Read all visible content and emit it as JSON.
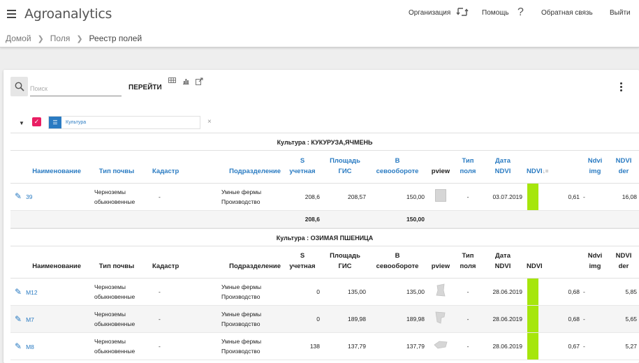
{
  "app": {
    "title": "Agroanalytics"
  },
  "topnav": {
    "organization": "Организация",
    "help": "Помощь",
    "feedback": "Обратная связь",
    "logout": "Выйти"
  },
  "breadcrumb": {
    "home": "Домой",
    "fields": "Поля",
    "current": "Реестр полей"
  },
  "toolbar": {
    "search_placeholder": "Поиск",
    "search_value": "",
    "go_label": "ПЕРЕЙТИ",
    "help_glyph": "?"
  },
  "filter": {
    "chip_label": "Культура",
    "close_glyph": "×"
  },
  "colors": {
    "accent_blue": "#2a7bc2",
    "checkbox_pink": "#e91e63",
    "ndvi_green": "#a6e60c"
  },
  "groups": [
    {
      "title": "Культура : КУКУРУЗА,ЯЧМЕНЬ",
      "header_style": "blue",
      "columns": {
        "name": "Наименование",
        "soil": "Тип почвы",
        "cadastre": "Кадастр",
        "division": "Подразделение",
        "s_acc_1": "S",
        "s_acc_2": "учетная",
        "area_gis_1": "Площадь",
        "area_gis_2": "ГИС",
        "rotation_1": "В",
        "rotation_2": "севообороте",
        "pview": "pview",
        "field_type_1": "Тип",
        "field_type_2": "поля",
        "ndvi_date_1": "Дата",
        "ndvi_date_2": "NDVI",
        "ndvi": "NDVI",
        "ndvi_sort": "↓=",
        "ndvi_img_1": "Ndvi",
        "ndvi_img_2": "img",
        "ndvi_der_1": "NDVI",
        "ndvi_der_2": "der"
      },
      "rows": [
        {
          "name": "39",
          "soil_1": "Черноземы",
          "soil_2": "обыкновенные",
          "cadastre": "-",
          "division_1": "Умные фермы",
          "division_2": "Производство",
          "s_acc": "208,6",
          "area_gis": "208,57",
          "rotation": "150,00",
          "field_type": "-",
          "ndvi_date": "03.07.2019",
          "ndvi": "0,61",
          "ndvi_img": "-",
          "ndvi_der": "16,08"
        }
      ],
      "totals": {
        "s_acc": "208,6",
        "rotation": "150,00"
      }
    },
    {
      "title": "Культура : ОЗИМАЯ ПШЕНИЦА",
      "header_style": "dark",
      "columns": {
        "name": "Наименование",
        "soil": "Тип почвы",
        "cadastre": "Кадастр",
        "division": "Подразделение",
        "s_acc_1": "S",
        "s_acc_2": "учетная",
        "area_gis_1": "Площадь",
        "area_gis_2": "ГИС",
        "rotation_1": "В",
        "rotation_2": "севообороте",
        "pview": "pview",
        "field_type_1": "Тип",
        "field_type_2": "поля",
        "ndvi_date_1": "Дата",
        "ndvi_date_2": "NDVI",
        "ndvi": "NDVI",
        "ndvi_img_1": "Ndvi",
        "ndvi_img_2": "img",
        "ndvi_der_1": "NDVI",
        "ndvi_der_2": "der"
      },
      "rows": [
        {
          "name": "М12",
          "soil_1": "Черноземы",
          "soil_2": "обыкновенные",
          "cadastre": "-",
          "division_1": "Умные фермы",
          "division_2": "Производство",
          "s_acc": "0",
          "area_gis": "135,00",
          "rotation": "135,00",
          "field_type": "-",
          "ndvi_date": "28.06.2019",
          "ndvi": "0,68",
          "ndvi_img": "-",
          "ndvi_der": "5,85"
        },
        {
          "name": "М7",
          "soil_1": "Черноземы",
          "soil_2": "обыкновенные",
          "cadastre": "-",
          "division_1": "Умные фермы",
          "division_2": "Производство",
          "s_acc": "0",
          "area_gis": "189,98",
          "rotation": "189,98",
          "field_type": "-",
          "ndvi_date": "28.06.2019",
          "ndvi": "0,68",
          "ndvi_img": "-",
          "ndvi_der": "5,65"
        },
        {
          "name": "М8",
          "soil_1": "Черноземы",
          "soil_2": "обыкновенные",
          "cadastre": "-",
          "division_1": "Умные фермы",
          "division_2": "Производство",
          "s_acc": "138",
          "area_gis": "137,79",
          "rotation": "137,79",
          "field_type": "-",
          "ndvi_date": "28.06.2019",
          "ndvi": "0,67",
          "ndvi_img": "-",
          "ndvi_der": "5,27"
        }
      ]
    }
  ]
}
